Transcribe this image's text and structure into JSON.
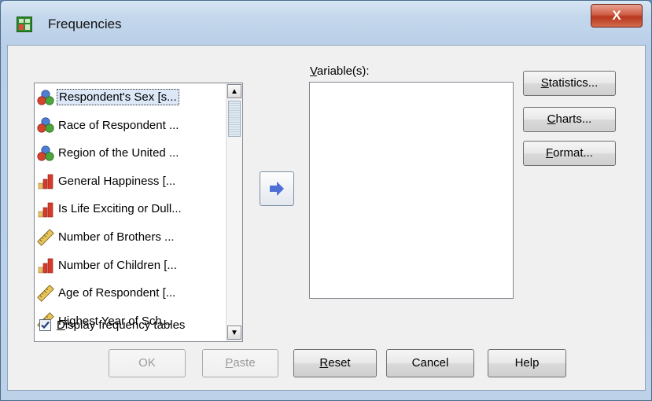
{
  "window": {
    "title": "Frequencies",
    "close_label": "X"
  },
  "variables": {
    "items": [
      {
        "label": "Respondent's Sex [s...",
        "icon": "nominal-icon",
        "selected": true
      },
      {
        "label": "Race of Respondent ...",
        "icon": "nominal-icon",
        "selected": false
      },
      {
        "label": "Region of the United ...",
        "icon": "nominal-icon",
        "selected": false
      },
      {
        "label": "General Happiness [...",
        "icon": "ordinal-icon",
        "selected": false
      },
      {
        "label": "Is Life Exciting or Dull...",
        "icon": "ordinal-icon",
        "selected": false
      },
      {
        "label": "Number of Brothers ...",
        "icon": "scale-icon",
        "selected": false
      },
      {
        "label": "Number of Children [...",
        "icon": "ordinal-icon",
        "selected": false
      },
      {
        "label": "Age of Respondent [...",
        "icon": "scale-icon",
        "selected": false
      },
      {
        "label": "Highest Year of Sch...",
        "icon": "scale-icon",
        "selected": false
      }
    ]
  },
  "target": {
    "label_accel": "V",
    "label_rest": "ariable(s):"
  },
  "side_buttons": {
    "statistics": {
      "accel": "S",
      "rest": "tatistics..."
    },
    "charts": {
      "accel": "C",
      "rest": "harts..."
    },
    "format": {
      "accel": "F",
      "rest": "ormat..."
    }
  },
  "checkbox": {
    "accel": "D",
    "rest": "isplay frequency tables",
    "checked": true
  },
  "bottom_buttons": {
    "ok": "OK",
    "paste": {
      "accel": "P",
      "rest": "aste"
    },
    "reset": {
      "accel": "R",
      "rest": "eset"
    },
    "cancel": "Cancel",
    "help": "Help"
  },
  "colors": {
    "nominal_red": "#d8432f",
    "nominal_green": "#4aa83a",
    "nominal_blue": "#4d7ed1",
    "ordinal_red": "#d83a2a",
    "scale_yellow": "#e7c458",
    "arrow_blue": "#4d6fd6"
  }
}
